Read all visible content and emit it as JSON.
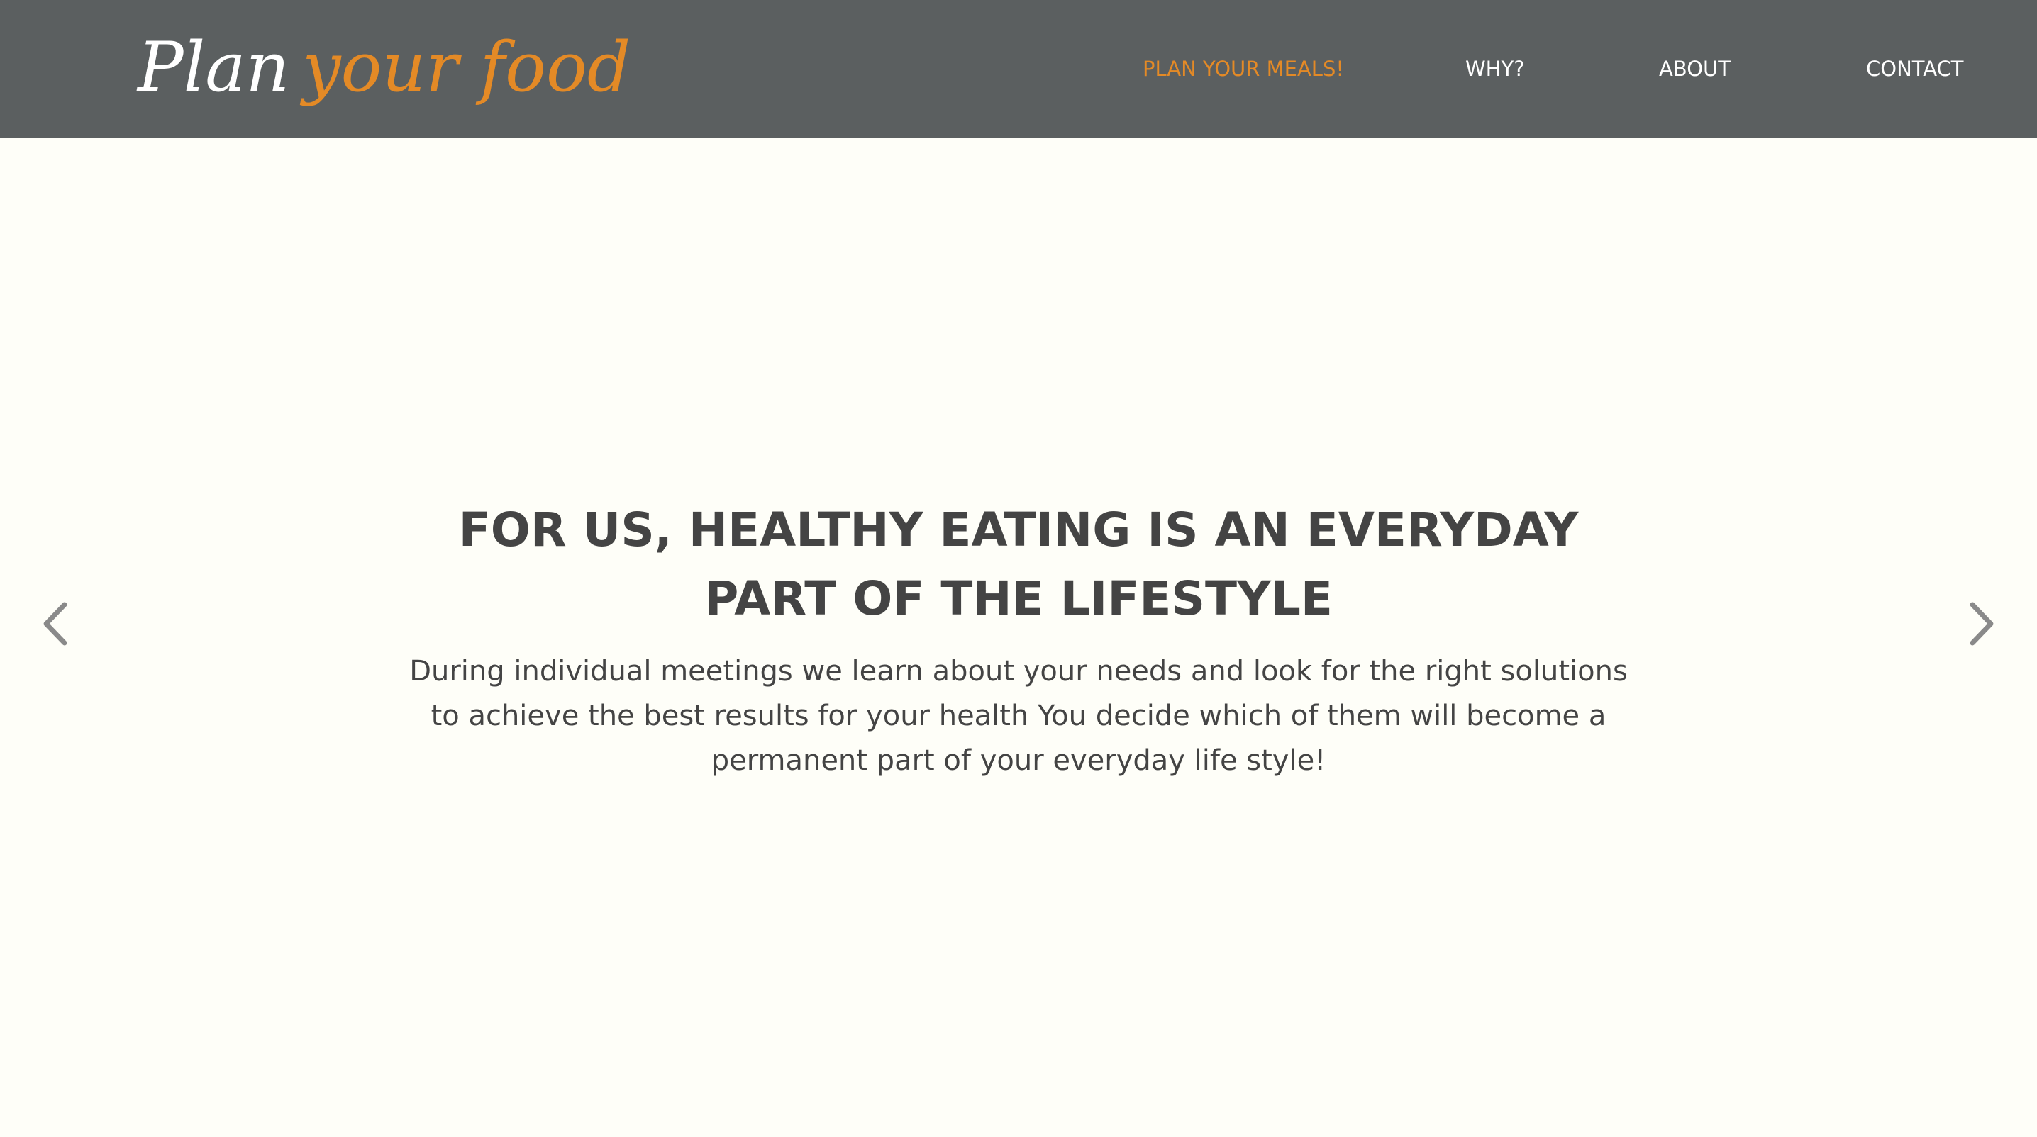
{
  "header": {
    "logo": {
      "part1": "Plan",
      "part2": "your food"
    },
    "nav": [
      {
        "label": "PLAN YOUR MEALS!",
        "active": true
      },
      {
        "label": "WHY?",
        "active": false
      },
      {
        "label": "ABOUT",
        "active": false
      },
      {
        "label": "CONTACT",
        "active": false
      }
    ]
  },
  "hero": {
    "title": "FOR US, HEALTHY EATING IS AN EVERYDAY PART OF THE LIFESTYLE",
    "text": "During individual meetings we learn about your needs and look for the right solutions to achieve the best results for your health You decide which of them will become a permanent part of your everyday life style!",
    "prev_icon": "chevron-left",
    "next_icon": "chevron-right"
  },
  "colors": {
    "header_bg": "#5b5f60",
    "accent": "#e48a26",
    "page_bg": "#fefef8",
    "text": "#444444"
  }
}
